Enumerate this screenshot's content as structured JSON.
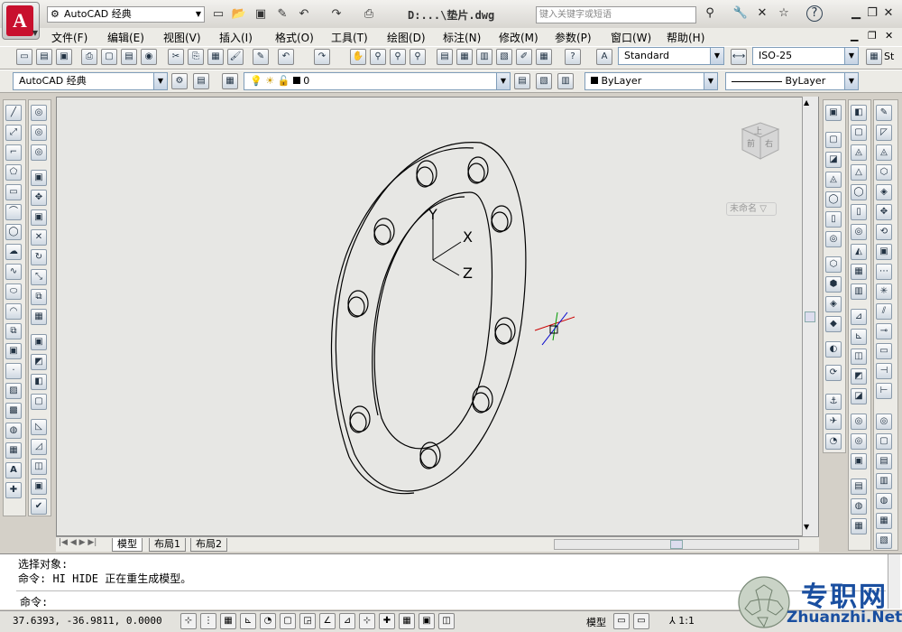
{
  "titlebar": {
    "workspace": "AutoCAD 经典",
    "file_title": "D:...\\垫片.dwg",
    "search_placeholder": "键入关键字或短语"
  },
  "menu": [
    "文件(F)",
    "编辑(E)",
    "视图(V)",
    "插入(I)",
    "格式(O)",
    "工具(T)",
    "绘图(D)",
    "标注(N)",
    "修改(M)",
    "参数(P)",
    "窗口(W)",
    "帮助(H)"
  ],
  "toolbar": {
    "text_style": "Standard",
    "dim_style": "ISO-25",
    "workspace_combo": "AutoCAD 经典",
    "layer": "0",
    "color": "ByLayer",
    "linetype": "ByLayer"
  },
  "viewcube": {
    "faces": [
      "上",
      "前",
      "右"
    ],
    "named_view": "未命名"
  },
  "ucs": {
    "x": "X",
    "y": "Y",
    "z": "Z"
  },
  "tabs": [
    "模型",
    "布局1",
    "布局2"
  ],
  "command": {
    "line1": "选择对象:",
    "line2": "命令: HI HIDE 正在重生成模型。",
    "prompt": "命令:"
  },
  "status": {
    "coords": "37.6393, -36.9811, 0.0000",
    "model": "模型",
    "scale": "1:1"
  },
  "watermark": {
    "cn": "专职网",
    "en": "Zhuanzhi.Net"
  },
  "icons": {
    "app": "autocad-logo",
    "search": "binoculars-icon",
    "help": "help-icon",
    "star": "star-icon"
  },
  "colors": {
    "accent": "#c8102e",
    "background": "#e7e7e4",
    "watermark": "#1a4fa0"
  }
}
